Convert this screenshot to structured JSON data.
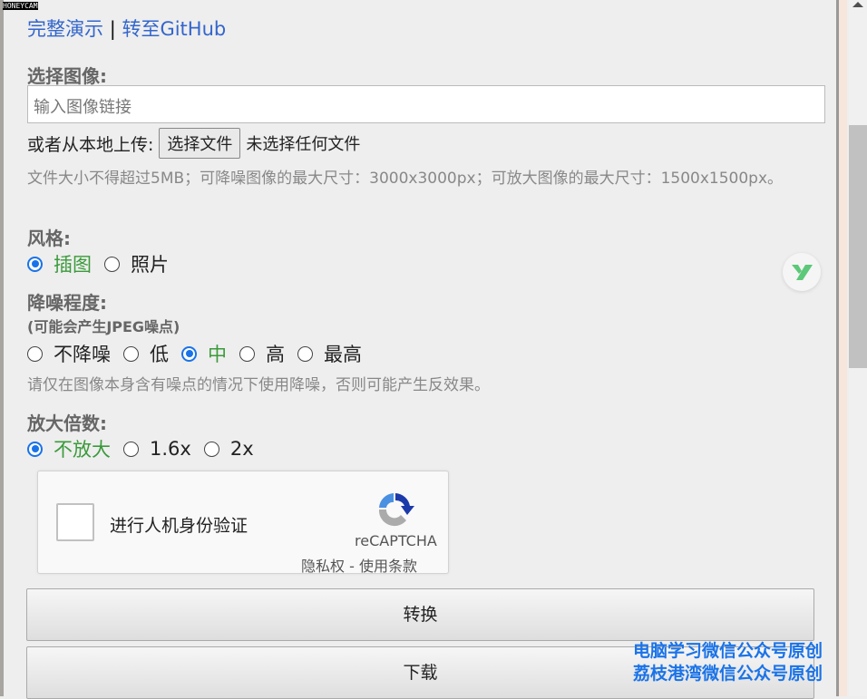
{
  "watermark": "HONEYCAM",
  "links": {
    "demo": "完整演示",
    "sep": "|",
    "github": "转至GitHub"
  },
  "image": {
    "label": "选择图像:",
    "placeholder": "输入图像链接",
    "upload_label": "或者从本地上传:",
    "file_button": "选择文件",
    "file_status": "未选择任何文件",
    "hint": "文件大小不得超过5MB；可降噪图像的最大尺寸：3000x3000px；可放大图像的最大尺寸：1500x1500px。"
  },
  "style": {
    "label": "风格:",
    "options": [
      "插图",
      "照片"
    ],
    "selected": "插图"
  },
  "noise": {
    "label": "降噪程度:",
    "sublabel": "(可能会产生JPEG噪点)",
    "options": [
      "不降噪",
      "低",
      "中",
      "高",
      "最高"
    ],
    "selected": "中",
    "hint": "请仅在图像本身含有噪点的情况下使用降噪，否则可能产生反效果。"
  },
  "scale": {
    "label": "放大倍数:",
    "options": [
      "不放大",
      "1.6x",
      "2x"
    ],
    "selected": "不放大"
  },
  "captcha": {
    "text": "进行人机身份验证",
    "brand": "reCAPTCHA",
    "privacy": "隐私权",
    "dash": "-",
    "terms": "使用条款"
  },
  "buttons": {
    "convert": "转换",
    "download": "下载"
  },
  "overlay": {
    "line1": "电脑学习微信公众号原创",
    "line2": "荔枝港湾微信公众号原创"
  }
}
